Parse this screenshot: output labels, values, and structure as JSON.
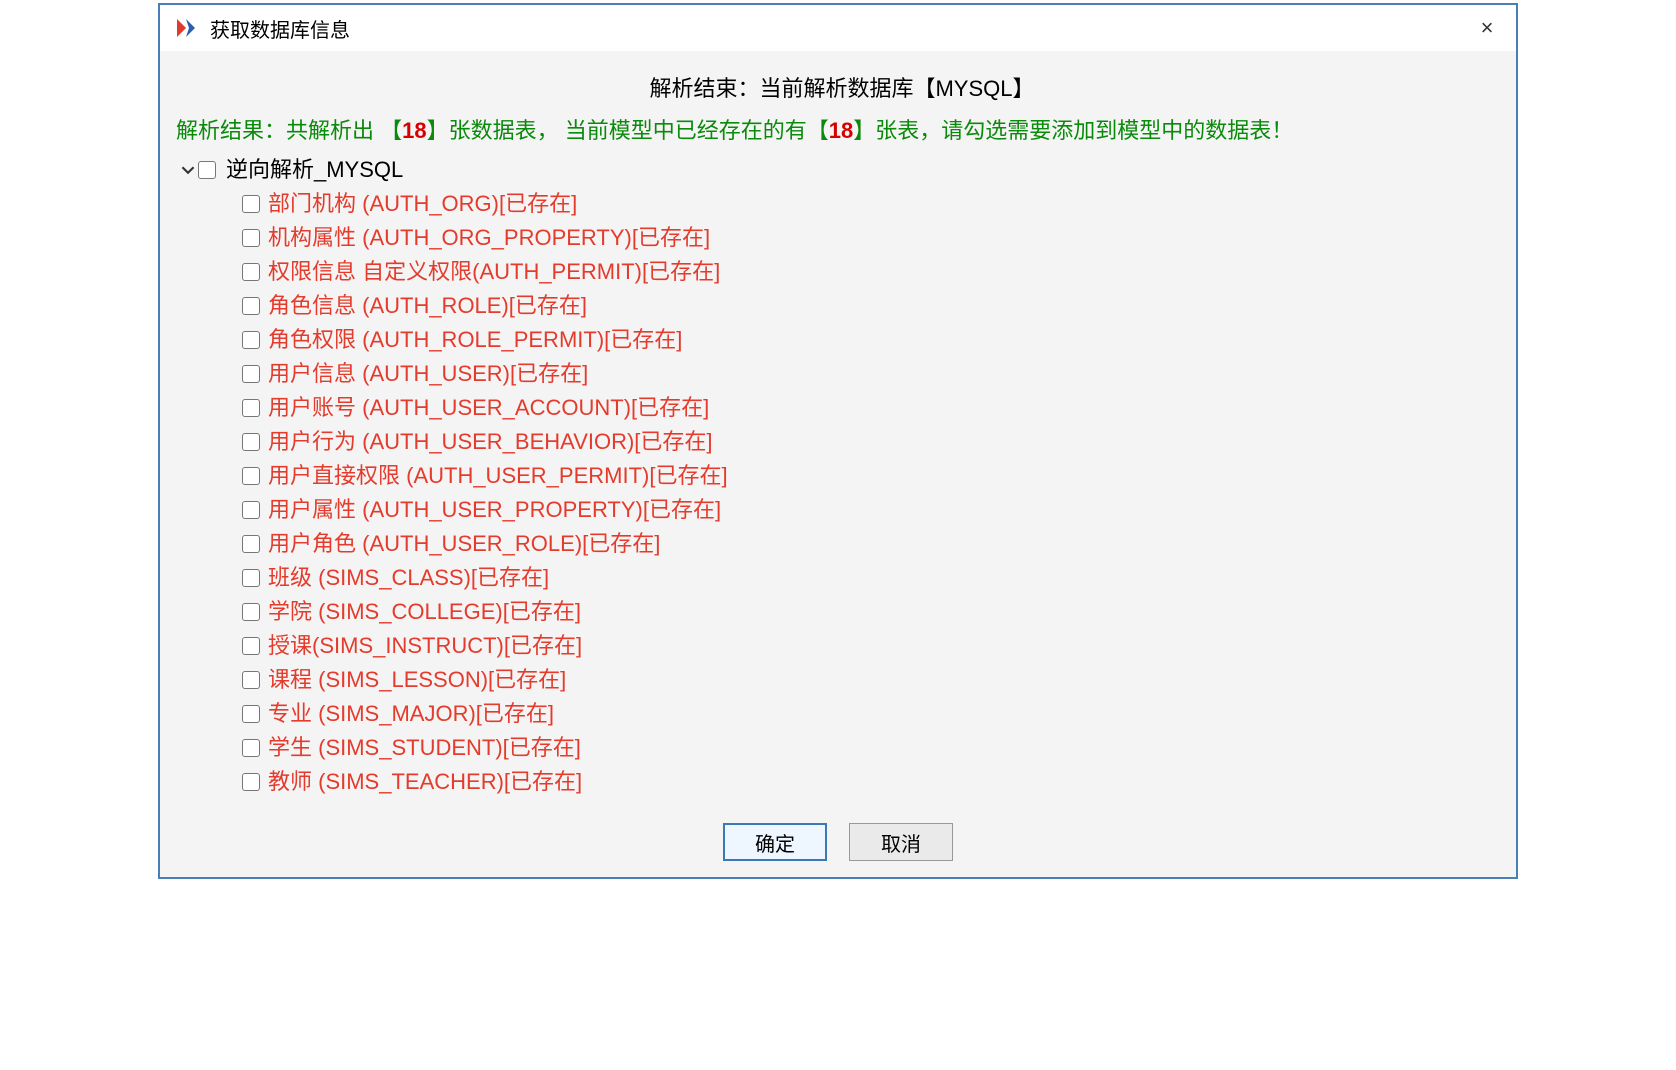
{
  "dialog": {
    "title": "获取数据库信息",
    "close_label": "×"
  },
  "heading": "解析结束：当前解析数据库【MYSQL】",
  "summary": {
    "prefix": "解析结果：共解析出 【",
    "count1": "18",
    "mid": "】张数据表，  当前模型中已经存在的有【",
    "count2": "18",
    "suffix": "】张表，请勾选需要添加到模型中的数据表！"
  },
  "tree": {
    "root_label": "逆向解析_MYSQL",
    "items": [
      "部门机构 (AUTH_ORG)[已存在]",
      "机构属性 (AUTH_ORG_PROPERTY)[已存在]",
      "权限信息 自定义权限(AUTH_PERMIT)[已存在]",
      "角色信息 (AUTH_ROLE)[已存在]",
      "角色权限 (AUTH_ROLE_PERMIT)[已存在]",
      "用户信息 (AUTH_USER)[已存在]",
      "用户账号 (AUTH_USER_ACCOUNT)[已存在]",
      "用户行为 (AUTH_USER_BEHAVIOR)[已存在]",
      "用户直接权限 (AUTH_USER_PERMIT)[已存在]",
      "用户属性 (AUTH_USER_PROPERTY)[已存在]",
      "用户角色 (AUTH_USER_ROLE)[已存在]",
      "班级 (SIMS_CLASS)[已存在]",
      "学院 (SIMS_COLLEGE)[已存在]",
      "授课(SIMS_INSTRUCT)[已存在]",
      "课程 (SIMS_LESSON)[已存在]",
      "专业 (SIMS_MAJOR)[已存在]",
      "学生 (SIMS_STUDENT)[已存在]",
      "教师 (SIMS_TEACHER)[已存在]"
    ]
  },
  "buttons": {
    "ok": "确定",
    "cancel": "取消"
  }
}
